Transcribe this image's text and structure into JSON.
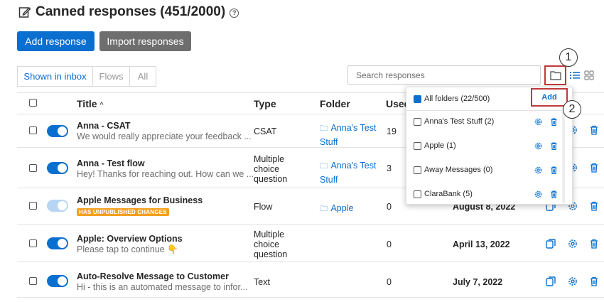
{
  "header": {
    "title": "Canned responses (451/2000)",
    "help_symbol": "?"
  },
  "toolbar": {
    "add_label": "Add response",
    "import_label": "Import responses"
  },
  "tabs": [
    {
      "label": "Shown in inbox",
      "active": true
    },
    {
      "label": "Flows",
      "active": false
    },
    {
      "label": "All",
      "active": false
    }
  ],
  "search": {
    "placeholder": "Search responses"
  },
  "table": {
    "headers": {
      "title": "Title",
      "sort": "^",
      "type": "Type",
      "folder": "Folder",
      "used": "Used"
    },
    "rows": [
      {
        "title": "Anna - CSAT",
        "sub": "We would really appreciate your feedback ...",
        "type": "CSAT",
        "folder": "Anna's Test Stuff",
        "used": "19",
        "date": "",
        "enabled": true
      },
      {
        "title": "Anna - Test flow",
        "sub": "Hey! Thanks for reaching out. How can we ...",
        "type": "Multiple choice question",
        "folder": "Anna's Test Stuff",
        "used": "3",
        "date": "",
        "enabled": true
      },
      {
        "title": "Apple Messages for Business",
        "badge": "HAS UNPUBLISHED CHANGES",
        "type": "Flow",
        "folder": "Apple",
        "used": "0",
        "date": "August 8, 2022",
        "enabled": false
      },
      {
        "title": "Apple: Overview Options",
        "sub": "Please tap to continue 👇",
        "type": "Multiple choice question",
        "folder": "",
        "used": "0",
        "date": "April 13, 2022",
        "enabled": true
      },
      {
        "title": "Auto-Resolve Message to Customer",
        "sub": "Hi - this is an automated message to infor...",
        "type": "Text",
        "folder": "",
        "used": "0",
        "date": "July 7, 2022",
        "enabled": true
      }
    ]
  },
  "folder_dropdown": {
    "all_label": "All folders (22/500)",
    "add_label": "Add",
    "folders": [
      {
        "label": "Anna's Test Stuff (2)"
      },
      {
        "label": "Apple (1)"
      },
      {
        "label": "Away Messages (0)"
      },
      {
        "label": "ClaraBank (5)"
      }
    ]
  },
  "callouts": {
    "one": "1",
    "two": "2"
  },
  "colors": {
    "accent": "#0a6fcf",
    "highlight": "#c0393b",
    "badge": "#f5a01f"
  }
}
